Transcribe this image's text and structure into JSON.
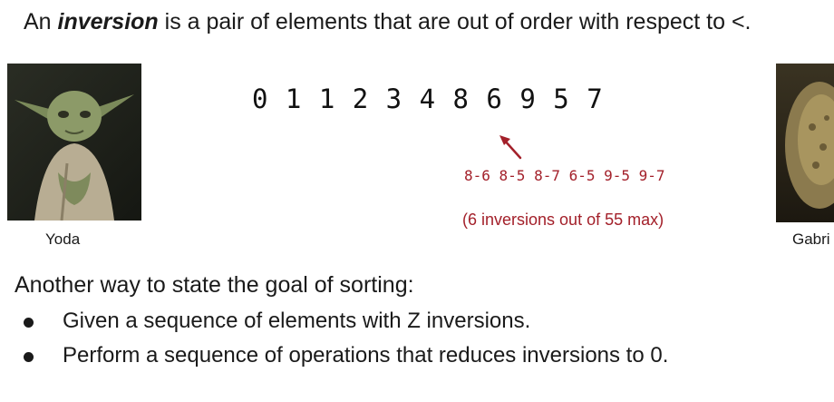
{
  "heading": {
    "prefix": "An ",
    "term": "inversion",
    "suffix": " is a pair of elements that are out of order with respect to <."
  },
  "left_figure": {
    "caption": "Yoda"
  },
  "right_figure": {
    "caption": "Gabri"
  },
  "sequence": "0 1 1 2 3 4 8 6 9 5 7",
  "inversion_pairs": "8-6 8-5 8-7 6-5 9-5 9-7",
  "inversion_count": "(6 inversions out of 55 max)",
  "subheading": "Another way to state the goal of sorting:",
  "bullets": [
    "Given a sequence of elements with Z inversions.",
    "Perform a sequence of operations that reduces inversions to 0."
  ],
  "colors": {
    "accent": "#a3202a",
    "text": "#1a1a1a"
  }
}
